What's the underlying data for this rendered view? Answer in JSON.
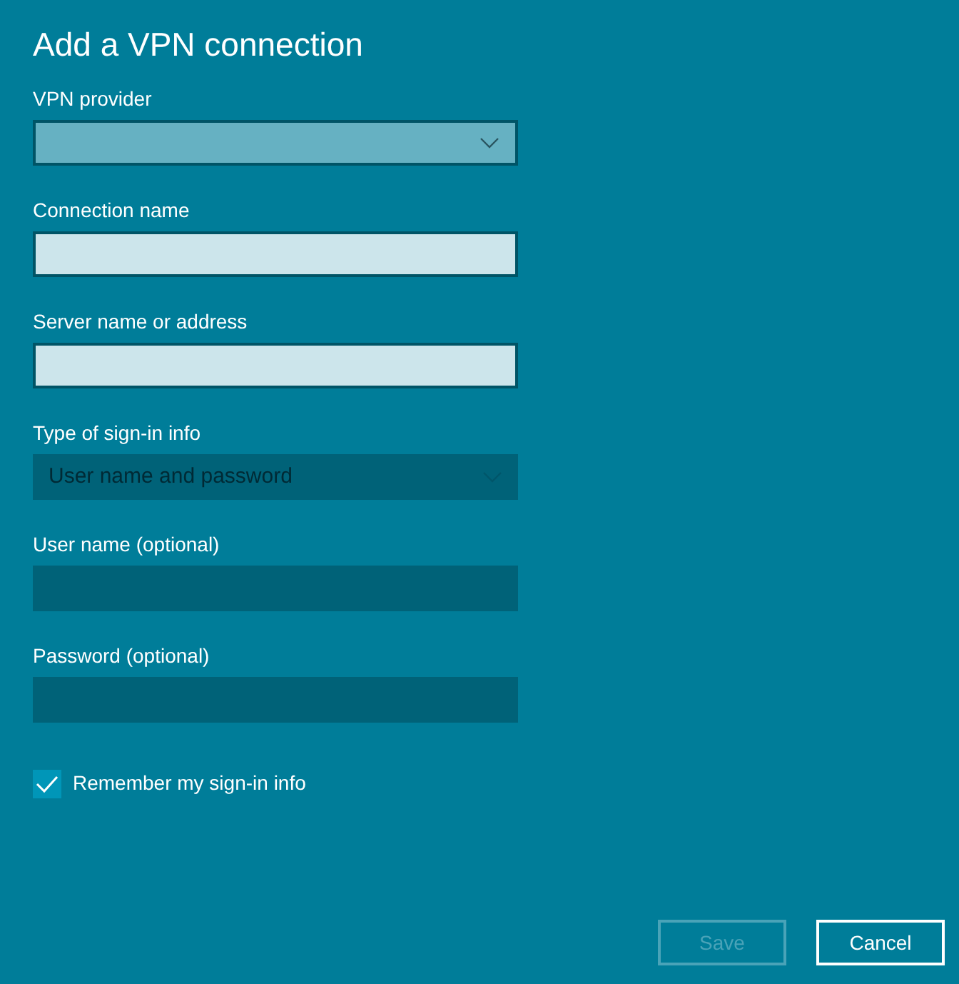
{
  "title": "Add a VPN connection",
  "fields": [
    {
      "label": "VPN provider",
      "kind": "dropdown",
      "disabled": false
    },
    {
      "label": "Connection name",
      "kind": "text",
      "disabled": false
    },
    {
      "label": "Server name or address",
      "kind": "text",
      "disabled": false
    },
    {
      "label": "Type of sign-in info",
      "kind": "dropdown",
      "disabled": true,
      "value": "User name and password"
    },
    {
      "label": "User name (optional)",
      "kind": "text",
      "disabled": true
    },
    {
      "label": "Password (optional)",
      "kind": "text",
      "disabled": true
    }
  ],
  "remember": {
    "label": "Remember my sign-in info",
    "checked": true
  },
  "buttons": [
    {
      "label": "Save",
      "disabled": true
    },
    {
      "label": "Cancel",
      "disabled": false
    }
  ]
}
